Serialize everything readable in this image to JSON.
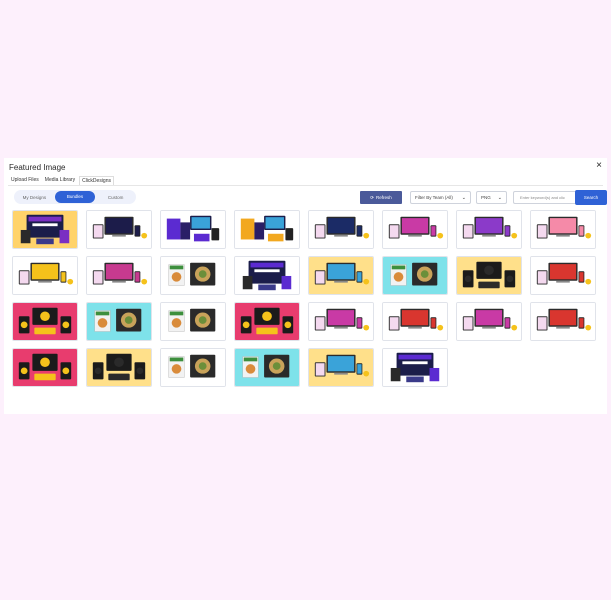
{
  "modal": {
    "title": "Featured Image",
    "close_label": "×",
    "tabs": [
      {
        "label": "Upload Files",
        "active": false
      },
      {
        "label": "Media Library",
        "active": false
      },
      {
        "label": "ClickDesigns",
        "active": true
      }
    ]
  },
  "filters": {
    "segments": [
      {
        "label": "My Designs",
        "active": false
      },
      {
        "label": "Bundles",
        "active": true
      },
      {
        "label": "Custom",
        "active": false
      }
    ],
    "refresh_label": "Refresh",
    "team_select": "Filter By Team (All)",
    "format_select": "PNG",
    "search_placeholder": "Enter keyword(s) and clic",
    "search_button": "Search"
  },
  "colors": {
    "primary": "#2f62d6",
    "refresh": "#4b5a9a",
    "page_bg": "#fdf0fc"
  },
  "thumbnails": [
    {
      "bg": "#ffd36b",
      "accent": "#7a2fc2",
      "theme": "voice"
    },
    {
      "bg": "#ffffff",
      "accent": "#1c1c4a",
      "theme": "devices"
    },
    {
      "bg": "#ffffff",
      "accent": "#5b2bd1",
      "theme": "boxes"
    },
    {
      "bg": "#ffffff",
      "accent": "#f2a81f",
      "theme": "boxes"
    },
    {
      "bg": "#ffffff",
      "accent": "#1b2b66",
      "theme": "devices"
    },
    {
      "bg": "#ffffff",
      "accent": "#c93aa5",
      "theme": "devices"
    },
    {
      "bg": "#ffffff",
      "accent": "#8b3ac9",
      "theme": "devices"
    },
    {
      "bg": "#ffffff",
      "accent": "#f58aa8",
      "theme": "devices"
    },
    {
      "bg": "#ffffff",
      "accent": "#f5c21b",
      "theme": "devices"
    },
    {
      "bg": "#ffffff",
      "accent": "#c73a8f",
      "theme": "devices"
    },
    {
      "bg": "#ffffff",
      "accent": "#2a2a2a",
      "theme": "food"
    },
    {
      "bg": "#ffffff",
      "accent": "#5b2bd1",
      "theme": "voice"
    },
    {
      "bg": "#ffe08a",
      "accent": "#3aa3d9",
      "theme": "devices"
    },
    {
      "bg": "#7ee2ea",
      "accent": "#2a2a2a",
      "theme": "food"
    },
    {
      "bg": "#ffe08a",
      "accent": "#2a2a2a",
      "theme": "coins"
    },
    {
      "bg": "#ffffff",
      "accent": "#d9362f",
      "theme": "devices"
    },
    {
      "bg": "#e83c6e",
      "accent": "#f5c21b",
      "theme": "coins"
    },
    {
      "bg": "#7ee2ea",
      "accent": "#2a2a2a",
      "theme": "food"
    },
    {
      "bg": "#ffffff",
      "accent": "#2a2a2a",
      "theme": "food"
    },
    {
      "bg": "#e83c6e",
      "accent": "#f5c21b",
      "theme": "coins"
    },
    {
      "bg": "#ffffff",
      "accent": "#c93aa5",
      "theme": "devices"
    },
    {
      "bg": "#ffffff",
      "accent": "#d9362f",
      "theme": "devices"
    },
    {
      "bg": "#ffffff",
      "accent": "#c93aa5",
      "theme": "devices"
    },
    {
      "bg": "#ffffff",
      "accent": "#d9362f",
      "theme": "devices"
    },
    {
      "bg": "#e83c6e",
      "accent": "#f5c21b",
      "theme": "coins"
    },
    {
      "bg": "#ffe08a",
      "accent": "#2a2a2a",
      "theme": "coins"
    },
    {
      "bg": "#ffffff",
      "accent": "#2a2a2a",
      "theme": "food"
    },
    {
      "bg": "#7ee2ea",
      "accent": "#2a2a2a",
      "theme": "food"
    },
    {
      "bg": "#ffe08a",
      "accent": "#3aa3d9",
      "theme": "devices"
    },
    {
      "bg": "#ffffff",
      "accent": "#5b2bd1",
      "theme": "voice"
    }
  ]
}
